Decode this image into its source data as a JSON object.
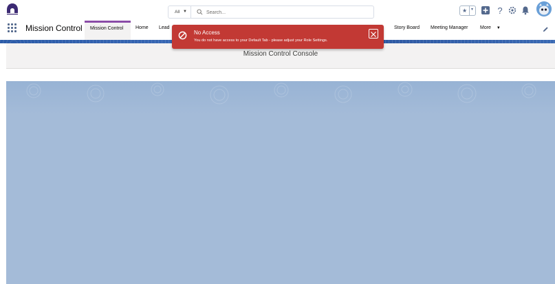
{
  "header": {
    "search": {
      "scope_label": "All",
      "placeholder": "Search..."
    }
  },
  "nav": {
    "app_name": "Mission Control",
    "tabs": [
      {
        "label": "Mission Control",
        "active": true
      },
      {
        "label": "Home"
      },
      {
        "label": "Lead"
      },
      {
        "label": "Story Board"
      },
      {
        "label": "Meeting Manager"
      },
      {
        "label": "More"
      }
    ]
  },
  "page": {
    "title": "Mission Control Console"
  },
  "toast": {
    "title": "No Access",
    "message": "You do not have access to your Default Tab - please adjust your Role Settings.",
    "color": "#c23934"
  },
  "colors": {
    "active_tab_accent": "#8a4ba7",
    "main_background": "#a4bbd8",
    "nav_strip": "#2b5ba8"
  },
  "icons": [
    "logo",
    "search-icon",
    "star-icon",
    "plus-icon",
    "help-icon",
    "gear-icon",
    "bell-icon",
    "avatar",
    "app-launcher-icon",
    "edit-icon",
    "no-access-icon",
    "close-icon"
  ]
}
